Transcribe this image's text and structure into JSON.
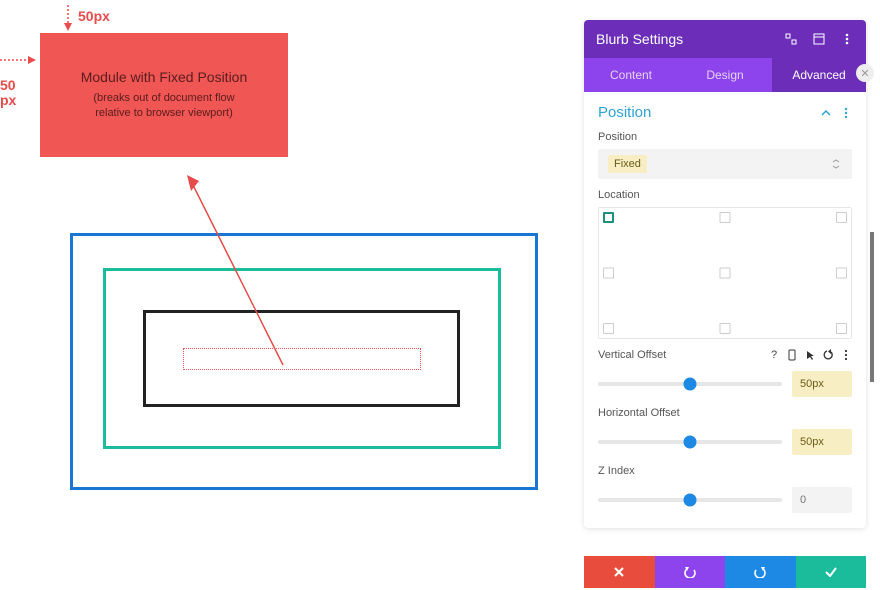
{
  "annotations": {
    "top_label": "50px",
    "left_label_l1": "50",
    "left_label_l2": "px"
  },
  "module": {
    "title": "Module with Fixed Position",
    "subtitle_l1": "(breaks out of document flow",
    "subtitle_l2": "relative to browser viewport)"
  },
  "panel": {
    "title": "Blurb Settings",
    "tabs": {
      "content": "Content",
      "design": "Design",
      "advanced": "Advanced"
    },
    "section": {
      "title": "Position"
    },
    "position_field": {
      "label": "Position",
      "value": "Fixed"
    },
    "location_field": {
      "label": "Location"
    },
    "vertical_offset": {
      "label": "Vertical Offset",
      "value": "50px"
    },
    "horizontal_offset": {
      "label": "Horizontal Offset",
      "value": "50px"
    },
    "z_index": {
      "label": "Z Index",
      "value": "0"
    }
  }
}
